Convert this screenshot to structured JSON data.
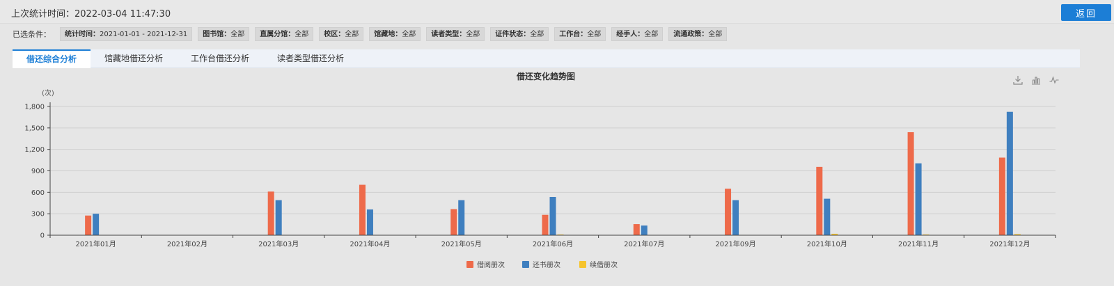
{
  "header": {
    "stat_time_label": "上次统计时间：",
    "stat_time_value": "2022-03-04 11:47:30",
    "back_label": "返回"
  },
  "filters": {
    "label": "已选条件：",
    "chips": [
      {
        "key": "统计时间：",
        "value": "2021-01-01 - 2021-12-31"
      },
      {
        "key": "图书馆：",
        "value": "全部"
      },
      {
        "key": "直属分馆：",
        "value": "全部"
      },
      {
        "key": "校区：",
        "value": "全部"
      },
      {
        "key": "馆藏地：",
        "value": "全部"
      },
      {
        "key": "读者类型：",
        "value": "全部"
      },
      {
        "key": "证件状态：",
        "value": "全部"
      },
      {
        "key": "工作台：",
        "value": "全部"
      },
      {
        "key": "经手人：",
        "value": "全部"
      },
      {
        "key": "流通政策：",
        "value": "全部"
      }
    ]
  },
  "tabs": [
    {
      "label": "借还综合分析",
      "active": true
    },
    {
      "label": "馆藏地借还分析",
      "active": false
    },
    {
      "label": "工作台借还分析",
      "active": false
    },
    {
      "label": "读者类型借还分析",
      "active": false
    }
  ],
  "toolbox": [
    "download-icon",
    "bar-chart-icon",
    "line-chart-icon"
  ],
  "chart_data": {
    "type": "bar",
    "title": "借还变化趋势图",
    "ylabel": "(次)",
    "xlabel": "",
    "ylim": [
      0,
      1800
    ],
    "yticks": [
      0,
      300,
      600,
      900,
      1200,
      1500,
      1800
    ],
    "ytick_labels": [
      "0",
      "300",
      "600",
      "900",
      "1,200",
      "1,500",
      "1,800"
    ],
    "grid": true,
    "legend": "bottom-center",
    "categories": [
      "2021年01月",
      "2021年02月",
      "2021年03月",
      "2021年04月",
      "2021年05月",
      "2021年06月",
      "2021年07月",
      "2021年09月",
      "2021年10月",
      "2021年11月",
      "2021年12月"
    ],
    "series": [
      {
        "name": "借阅册次",
        "color": "#ee6a4a",
        "values": [
          275,
          0,
          610,
          705,
          365,
          285,
          155,
          650,
          955,
          1440,
          1085
        ]
      },
      {
        "name": "还书册次",
        "color": "#3f7fbf",
        "values": [
          300,
          0,
          490,
          360,
          490,
          535,
          135,
          490,
          510,
          1005,
          1725
        ]
      },
      {
        "name": "续借册次",
        "color": "#f6c42e",
        "values": [
          0,
          0,
          0,
          0,
          0,
          10,
          0,
          5,
          20,
          10,
          15
        ]
      }
    ]
  }
}
